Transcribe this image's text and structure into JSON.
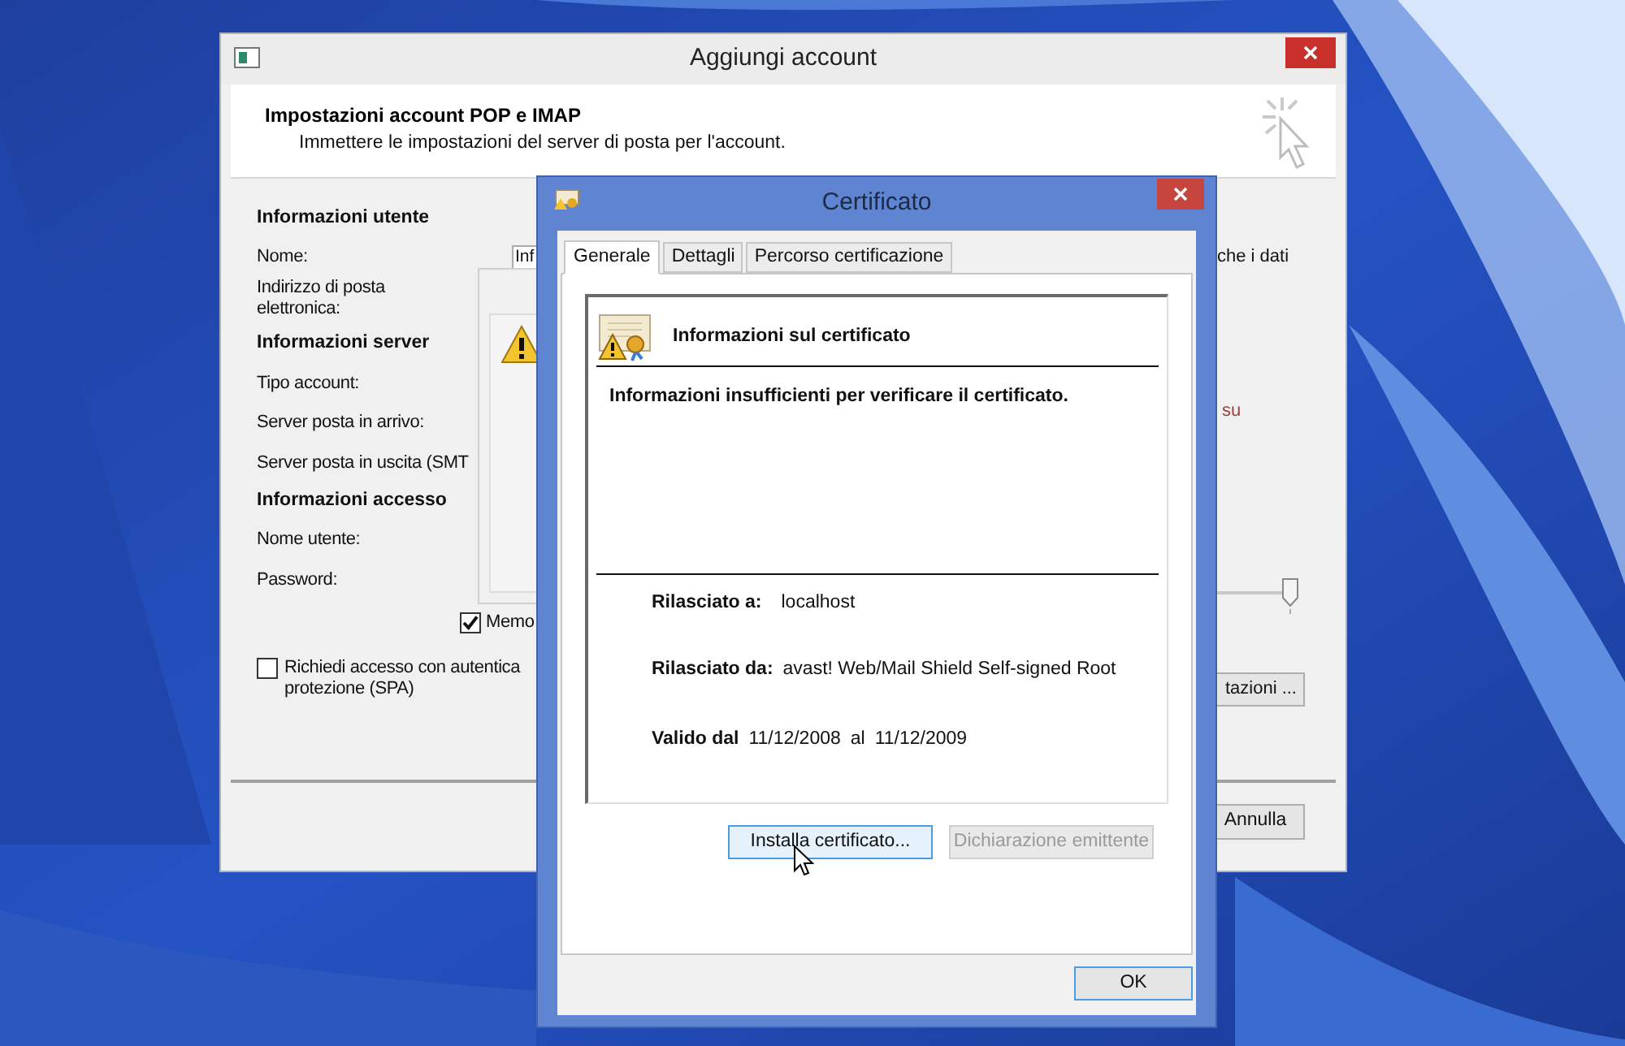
{
  "back_window": {
    "title": "Aggiungi account",
    "header_title": "Impostazioni account POP e IMAP",
    "header_subtitle": "Immettere le impostazioni del server di posta per l'account.",
    "sections": [
      {
        "heading": "Informazioni utente",
        "fields": [
          {
            "label": "Nome:",
            "kind": "single",
            "value": "Inf"
          },
          {
            "label": "Indirizzo di posta elettronica:",
            "kind": "wrapped"
          }
        ]
      },
      {
        "heading": "Informazioni server",
        "fields": [
          {
            "label": "Tipo account:",
            "kind": "single"
          },
          {
            "label": "Server posta in arrivo:",
            "kind": "single"
          },
          {
            "label": "Server posta in uscita (SMT",
            "kind": "single"
          }
        ]
      },
      {
        "heading": "Informazioni accesso",
        "fields": [
          {
            "label": "Nome utente:",
            "kind": "single"
          },
          {
            "label": "Password:",
            "kind": "single"
          }
        ]
      }
    ],
    "remember": {
      "label": "Memo",
      "checked": true
    },
    "spa": {
      "lines": [
        "Richiedi accesso con autentica",
        "protezione (SPA)"
      ],
      "checked": false
    },
    "right_text": "che i dati",
    "right_note": "su",
    "slider": {
      "level": 1
    },
    "more_button": "tazioni ...",
    "cancel_button": "Annulla"
  },
  "cert_window": {
    "title": "Certificato",
    "tabs": [
      {
        "label": "Generale",
        "selected": true
      },
      {
        "label": "Dettagli",
        "selected": false
      },
      {
        "label": "Percorso certificazione",
        "selected": false
      }
    ],
    "heading": "Informazioni sul certificato",
    "message": "Informazioni insufficienti per verificare il certificato.",
    "issued_to": {
      "label": "Rilasciato a:",
      "value": "localhost"
    },
    "issued_by": {
      "label": "Rilasciato da:",
      "value": "avast! Web/Mail Shield Self-signed Root"
    },
    "valid": {
      "label": "Valido dal",
      "from": "11/12/2008",
      "sep": "al",
      "to": "11/12/2009"
    },
    "buttons": [
      {
        "label": "Installa certificato...",
        "disabled": false,
        "hovered": true
      },
      {
        "label": "Dichiarazione emittente",
        "disabled": true,
        "hovered": false
      }
    ],
    "ok": "OK"
  }
}
